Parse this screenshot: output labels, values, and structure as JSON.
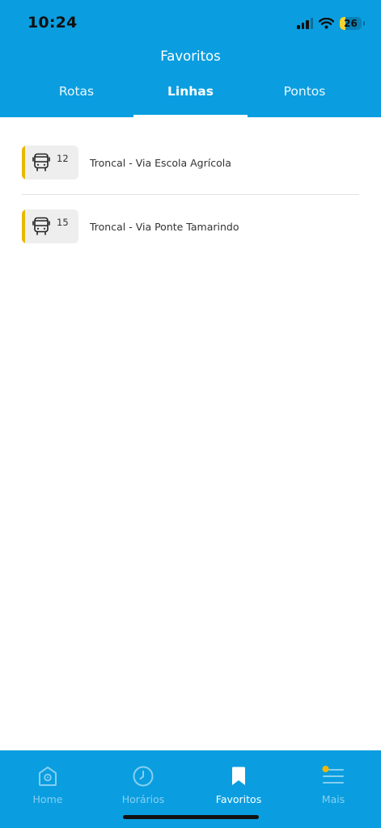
{
  "status_bar": {
    "time": "10:24",
    "battery_level": "26",
    "battery_fraction": 0.26,
    "battery_color": "#f5d432"
  },
  "header": {
    "title": "Favoritos",
    "background": "#0a9ee0"
  },
  "tabs": [
    {
      "label": "Rotas",
      "active": false
    },
    {
      "label": "Linhas",
      "active": true
    },
    {
      "label": "Pontos",
      "active": false
    }
  ],
  "lines": [
    {
      "number": "12",
      "name": "Troncal - Via Escola Agrícola",
      "icon": "bus-icon",
      "accent": "#e8b800"
    },
    {
      "number": "15",
      "name": "Troncal - Via Ponte Tamarindo",
      "icon": "bus-icon",
      "accent": "#e8b800"
    }
  ],
  "bottom_nav": [
    {
      "label": "Home",
      "icon": "home-icon",
      "active": false
    },
    {
      "label": "Horários",
      "icon": "clock-icon",
      "active": false
    },
    {
      "label": "Favoritos",
      "icon": "bookmark-icon",
      "active": true
    },
    {
      "label": "Mais",
      "icon": "menu-icon",
      "active": false
    }
  ],
  "colors": {
    "primary": "#0a9ee0",
    "notification_dot": "#f5b700"
  }
}
